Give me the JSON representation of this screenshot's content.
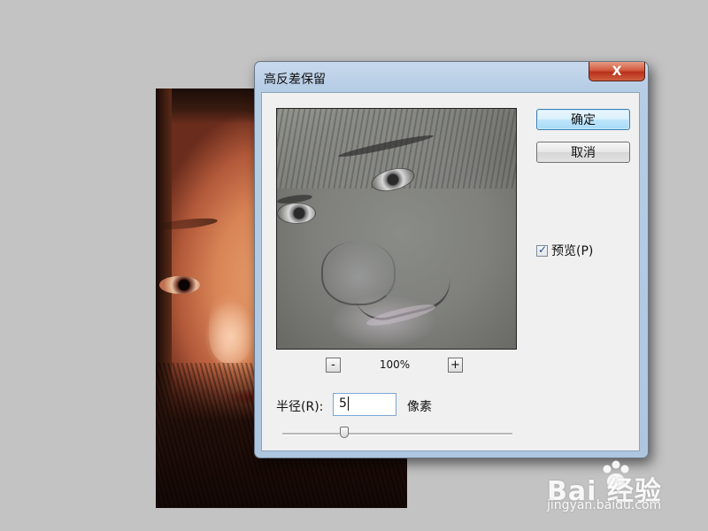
{
  "dialog": {
    "title": "高反差保留",
    "close_symbol": "X"
  },
  "preview": {
    "zoom_out_symbol": "-",
    "zoom_in_symbol": "+",
    "zoom_level": "100%"
  },
  "buttons": {
    "ok_label": "确定",
    "cancel_label": "取消"
  },
  "preview_checkbox": {
    "label": "预览(P)",
    "checked": true
  },
  "radius": {
    "label": "半径(R):",
    "value": "5",
    "unit": "像素",
    "slider_fraction": 0.27
  },
  "watermark": {
    "brand": "Bai 经验",
    "url": "jingyan.baidu.com"
  },
  "colors": {
    "background": "#c3c3c3",
    "close_button": "#c8452c",
    "primary_button": "#bee6fd"
  },
  "icons": {
    "close": "close-icon",
    "checkbox": "checkmark-icon",
    "watermark": "paw-icon"
  }
}
